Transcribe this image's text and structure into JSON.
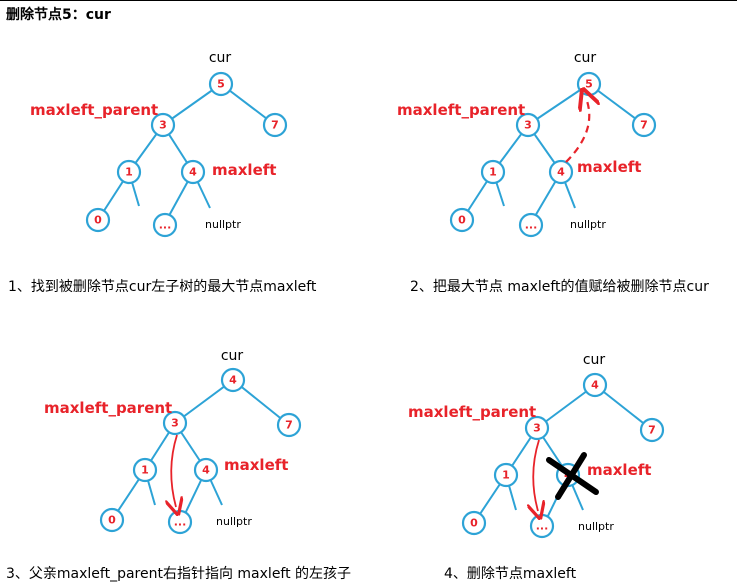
{
  "title": "删除节点5：cur",
  "panels": [
    {
      "cur_label": "cur",
      "nodes": {
        "root": "5",
        "left": "3",
        "right": "7",
        "ll": "1",
        "lr": "4",
        "lll": "0",
        "lrl": "..."
      },
      "maxleft_parent_label": "maxleft_parent",
      "maxleft_label": "maxleft",
      "nullptr_label": "nullptr",
      "caption": "1、找到被删除节点cur左子树的最大节点maxleft"
    },
    {
      "cur_label": "cur",
      "nodes": {
        "root": "5",
        "left": "3",
        "right": "7",
        "ll": "1",
        "lr": "4",
        "lll": "0",
        "lrl": "..."
      },
      "maxleft_parent_label": "maxleft_parent",
      "maxleft_label": "maxleft",
      "nullptr_label": "nullptr",
      "caption": "2、把最大节点 maxleft的值赋给被删除节点cur"
    },
    {
      "cur_label": "cur",
      "nodes": {
        "root": "4",
        "left": "3",
        "right": "7",
        "ll": "1",
        "lr": "4",
        "lll": "0",
        "lrl": "..."
      },
      "maxleft_parent_label": "maxleft_parent",
      "maxleft_label": "maxleft",
      "nullptr_label": "nullptr",
      "caption": "3、父亲maxleft_parent右指针指向 maxleft 的左孩子"
    },
    {
      "cur_label": "cur",
      "nodes": {
        "root": "4",
        "left": "3",
        "right": "7",
        "ll": "1",
        "lr": "4",
        "lll": "0",
        "lrl": "..."
      },
      "maxleft_parent_label": "maxleft_parent",
      "maxleft_label": "maxleft",
      "nullptr_label": "nullptr",
      "caption": "4、删除节点maxleft"
    }
  ],
  "colors": {
    "node_stroke": "#2da3d6",
    "label_red": "#e8232a",
    "arrow_red": "#e8232a"
  }
}
